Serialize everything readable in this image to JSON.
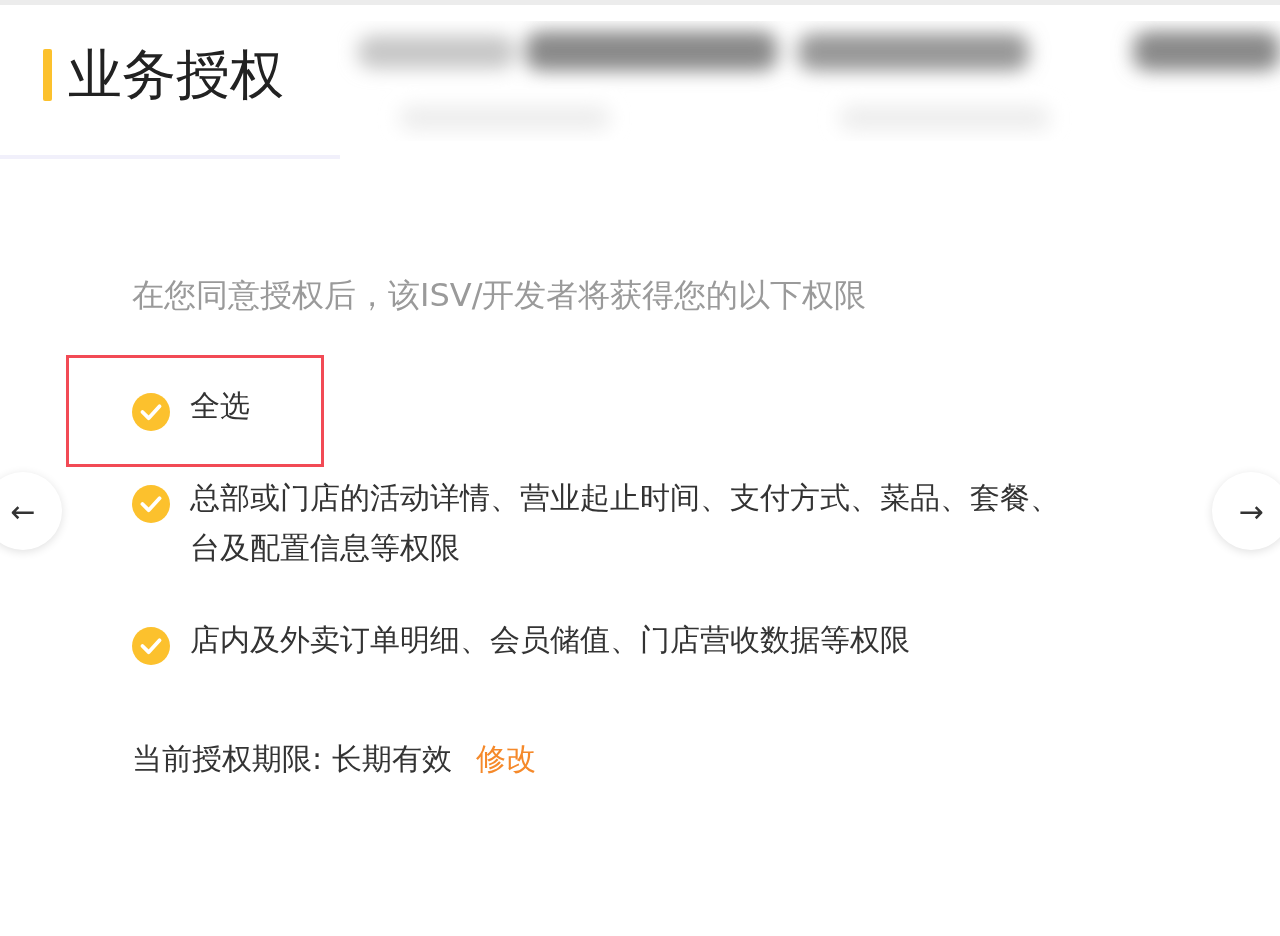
{
  "header": {
    "title": "业务授权"
  },
  "intro": "在您同意授权后，该ISV/开发者将获得您的以下权限",
  "permissions": [
    {
      "lines": [
        "全选"
      ],
      "checked": true,
      "highlighted": true
    },
    {
      "lines": [
        "总部或门店的活动详情、营业起止时间、支付方式、菜品、套餐、",
        "台及配置信息等权限"
      ],
      "checked": true,
      "highlighted": false
    },
    {
      "lines": [
        "店内及外卖订单明细、会员储值、门店营收数据等权限"
      ],
      "checked": true,
      "highlighted": false
    }
  ],
  "nav": {
    "prev": "←",
    "next": "→"
  },
  "period": {
    "label": "当前授权期限: 长期有效",
    "action": "修改"
  }
}
